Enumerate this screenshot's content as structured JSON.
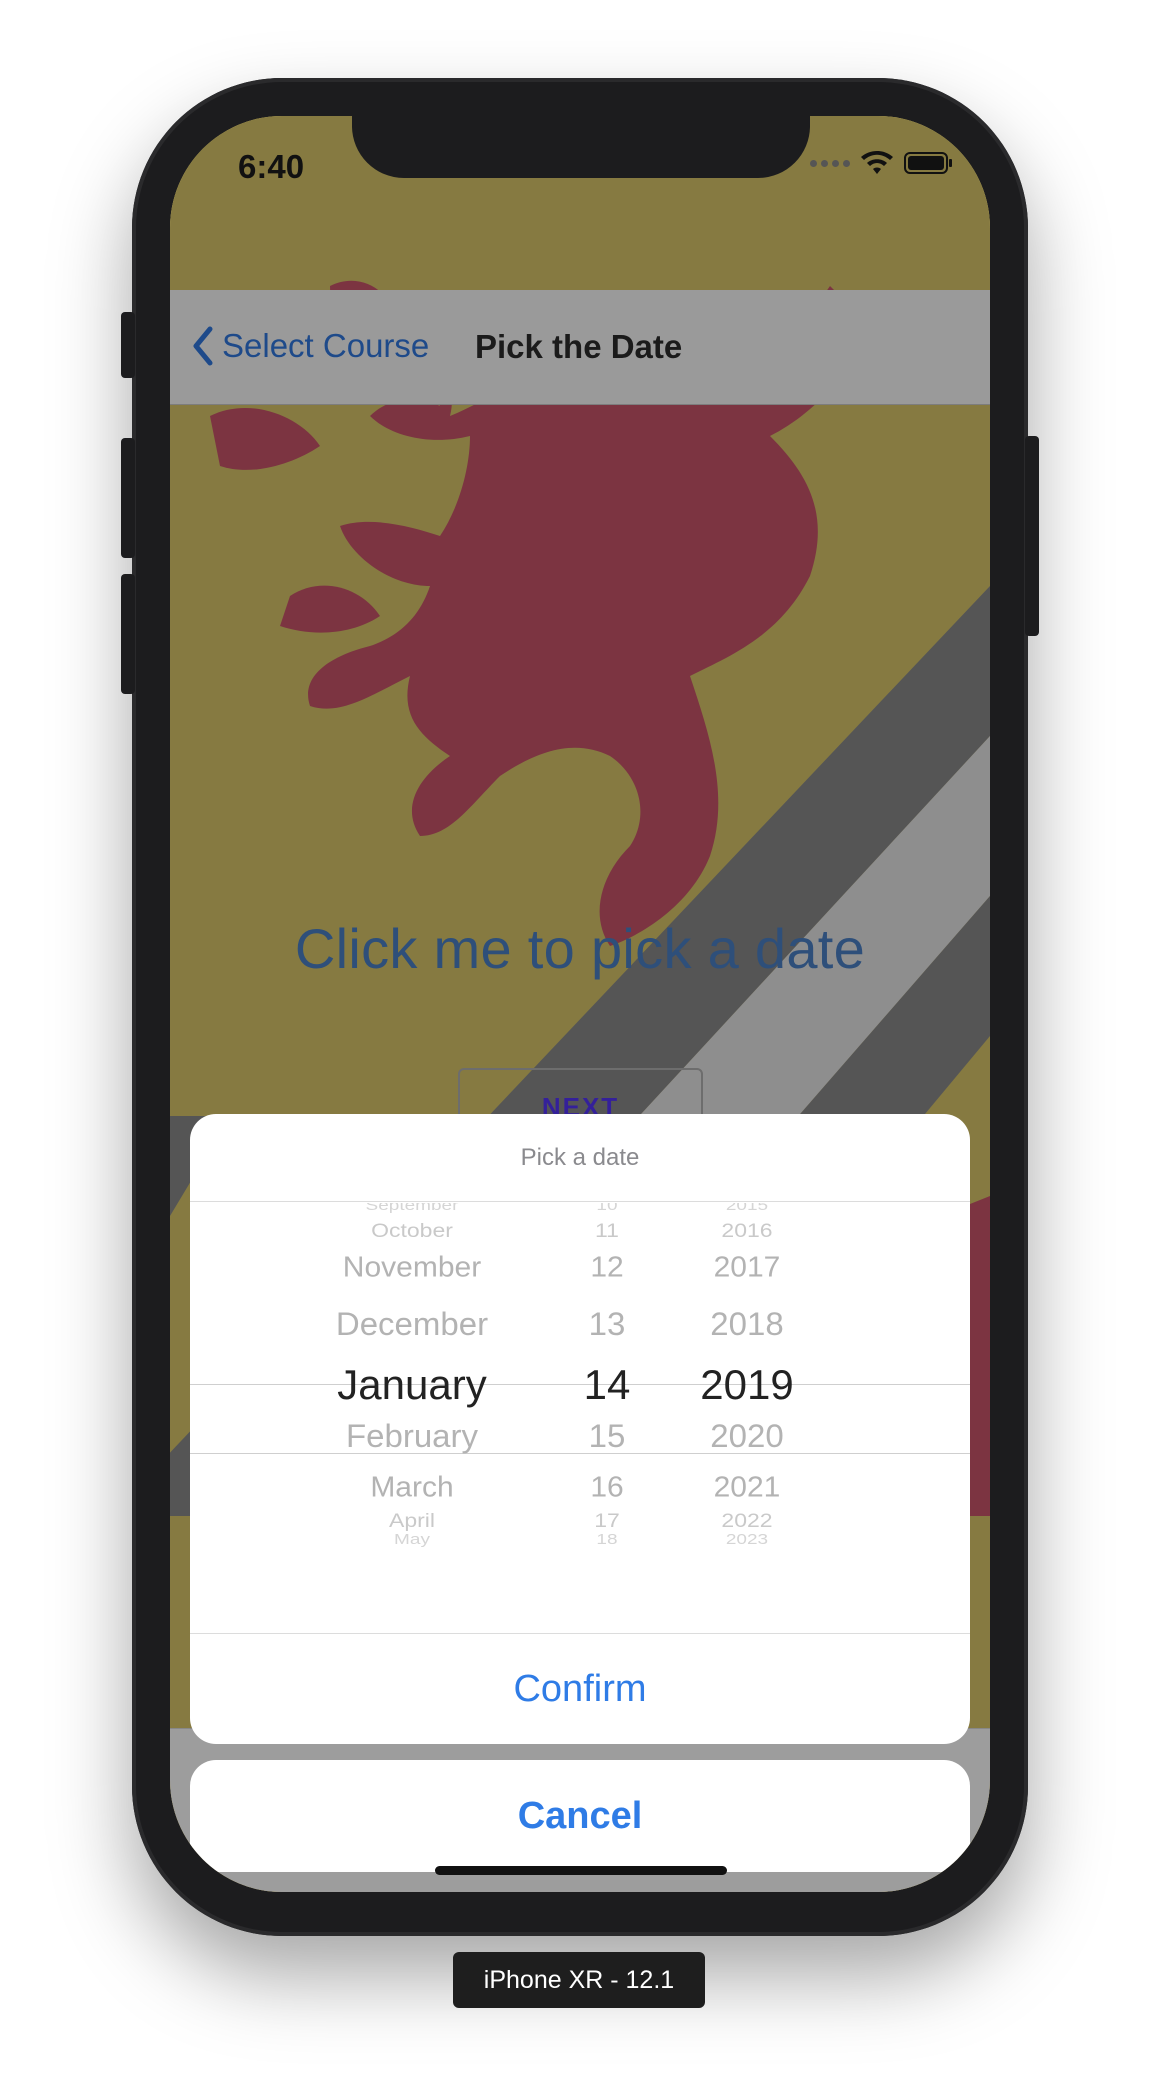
{
  "status_bar": {
    "time": "6:40"
  },
  "nav": {
    "back_label": "Select Course",
    "title": "Pick the Date"
  },
  "content": {
    "headline": "Click me to pick a date",
    "next_label": "NEXT"
  },
  "date_picker": {
    "title": "Pick a date",
    "months": [
      "September",
      "October",
      "November",
      "December",
      "January",
      "February",
      "March",
      "April",
      "May"
    ],
    "days": [
      "10",
      "11",
      "12",
      "13",
      "14",
      "15",
      "16",
      "17",
      "18"
    ],
    "years": [
      "2015",
      "2016",
      "2017",
      "2018",
      "2019",
      "2020",
      "2021",
      "2022",
      "2023"
    ],
    "selected": {
      "month": "January",
      "day": "14",
      "year": "2019"
    }
  },
  "actions": {
    "confirm_label": "Confirm",
    "cancel_label": "Cancel"
  },
  "device_label": "iPhone XR - 12.1",
  "colors": {
    "accent": "#2f7ce6",
    "next_text": "#34209a",
    "flag_yellow": "#d8c56a",
    "flag_red": "#c8556a"
  }
}
